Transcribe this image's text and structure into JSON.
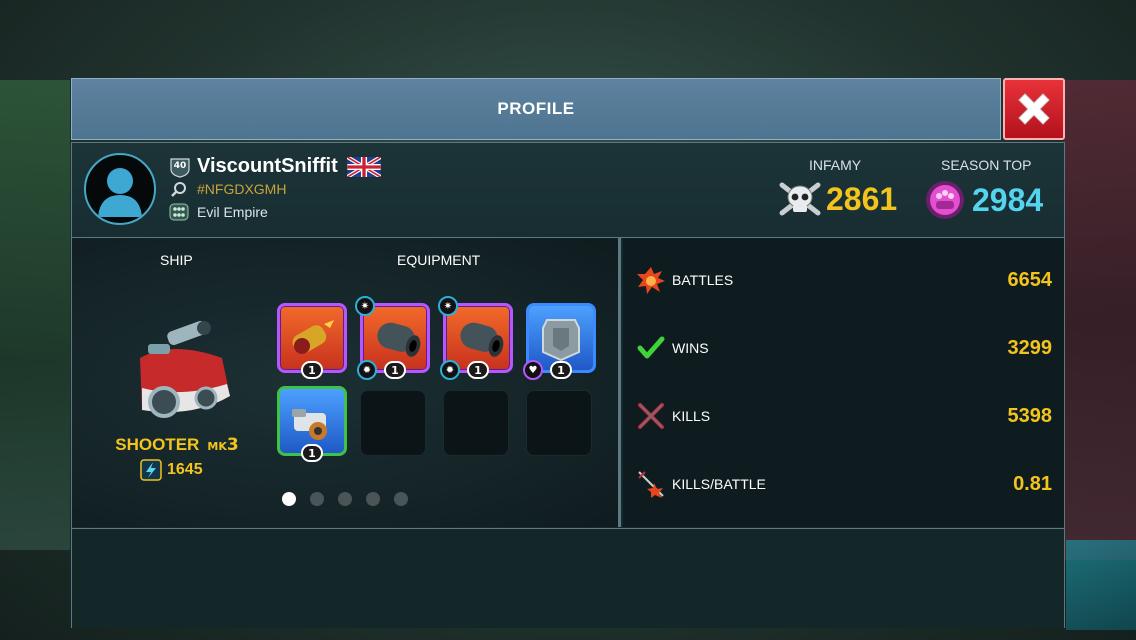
{
  "title": "PROFILE",
  "player": {
    "level": "40",
    "name": "ViscountSniffit",
    "tag": "#NFGDXGMH",
    "clan": "Evil Empire"
  },
  "infamy": {
    "label": "INFAMY",
    "value": "2861",
    "color": "#f2c41c"
  },
  "season_top": {
    "label": "SEASON TOP",
    "value": "2984",
    "color": "#55d4f0"
  },
  "ship_section": {
    "label": "SHIP",
    "ship_name": "SHOOTER",
    "mark_prefix": "MK",
    "mark_level": "3",
    "power": "1645"
  },
  "equipment": {
    "label": "EQUIPMENT",
    "slots": [
      {
        "icon": "flame-cannon-icon",
        "level": "1",
        "rarity": "purple"
      },
      {
        "icon": "cannon-icon",
        "level": "1",
        "rarity": "purple"
      },
      {
        "icon": "cannon-icon",
        "level": "1",
        "rarity": "purple"
      },
      {
        "icon": "armor-plate-icon",
        "level": "1",
        "rarity": "blue"
      },
      {
        "icon": "turret-icon",
        "level": "1",
        "rarity": "green"
      }
    ],
    "page_count": 5,
    "active_page": 1
  },
  "stats": [
    {
      "icon": "explosion-icon",
      "label": "BATTLES",
      "value": "6654"
    },
    {
      "icon": "checkmark-icon",
      "label": "WINS",
      "value": "3299"
    },
    {
      "icon": "crossed-swords-icon",
      "label": "KILLS",
      "value": "5398"
    },
    {
      "icon": "kill-ratio-icon",
      "label": "KILLS/BATTLE",
      "value": "0.81"
    }
  ]
}
